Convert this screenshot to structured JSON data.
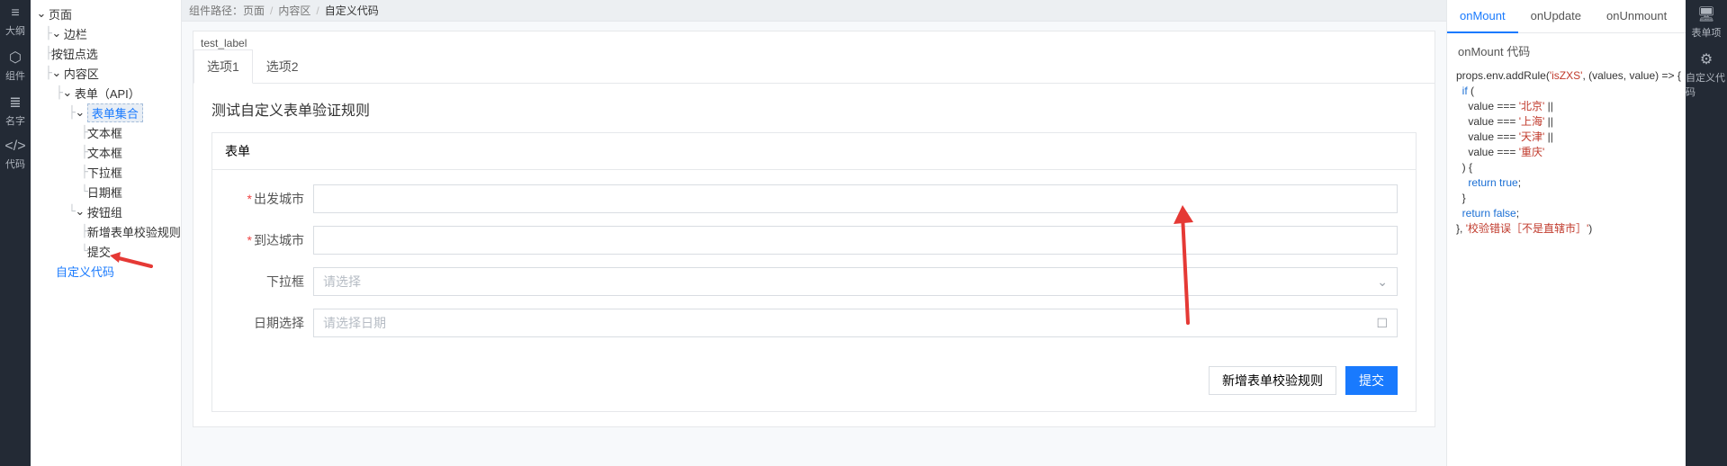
{
  "left_rail": [
    {
      "icon": "≡",
      "label": "大纲"
    },
    {
      "icon": "⬡",
      "label": "组件"
    },
    {
      "icon": "≣",
      "label": "名字"
    },
    {
      "icon": "</>",
      "label": "代码"
    }
  ],
  "tree": {
    "root_label": "页面",
    "items": [
      {
        "label": "边栏",
        "indent": 1
      },
      {
        "label": "按钮点选",
        "indent": 1
      },
      {
        "label": "内容区",
        "indent": 0,
        "collapsible": true
      },
      {
        "label": "表单（API）",
        "indent": 1,
        "collapsible": true
      },
      {
        "label": "表单集合",
        "indent": 2,
        "collapsible": true,
        "highlight": true
      },
      {
        "label": "文本框",
        "indent": 3
      },
      {
        "label": "文本框",
        "indent": 3
      },
      {
        "label": "下拉框",
        "indent": 3
      },
      {
        "label": "日期框",
        "indent": 3
      },
      {
        "label": "按钮组",
        "indent": 2,
        "collapsible": true
      },
      {
        "label": "新增表单校验规则",
        "indent": 3
      },
      {
        "label": "提交",
        "indent": 3
      },
      {
        "label": "自定义代码",
        "indent": -1,
        "link": true
      }
    ]
  },
  "breadcrumb": {
    "label_prefix": "组件路径：",
    "parts": [
      "页面",
      "内容区",
      "自定义代码"
    ]
  },
  "card": {
    "label": "test_label",
    "tabs": [
      "选项1",
      "选项2"
    ],
    "title": "测试自定义表单验证规则",
    "form_title": "表单",
    "fields": [
      {
        "label": "出发城市",
        "required": true,
        "type": "text"
      },
      {
        "label": "到达城市",
        "required": true,
        "type": "text"
      },
      {
        "label": "下拉框",
        "required": false,
        "type": "select",
        "placeholder": "请选择"
      },
      {
        "label": "日期选择",
        "required": false,
        "type": "date",
        "placeholder": "请选择日期"
      }
    ],
    "buttons": {
      "add_rule": "新增表单校验规则",
      "submit": "提交"
    }
  },
  "code_panel": {
    "tabs": [
      "onMount",
      "onUpdate",
      "onUnmount"
    ],
    "active_tab": 0,
    "title": "onMount 代码",
    "code_tokens": [
      {
        "t": "props.env.addRule(",
        "c": "pl"
      },
      {
        "t": "'isZXS'",
        "c": "str"
      },
      {
        "t": ", (values, value) => {\n  ",
        "c": "pl"
      },
      {
        "t": "if",
        "c": "kw"
      },
      {
        "t": " (\n    value === ",
        "c": "pl"
      },
      {
        "t": "'北京'",
        "c": "str"
      },
      {
        "t": " ||\n    value === ",
        "c": "pl"
      },
      {
        "t": "'上海'",
        "c": "str"
      },
      {
        "t": " ||\n    value === ",
        "c": "pl"
      },
      {
        "t": "'天津'",
        "c": "str"
      },
      {
        "t": " ||\n    value === ",
        "c": "pl"
      },
      {
        "t": "'重庆'",
        "c": "str"
      },
      {
        "t": "\n  ) {\n    ",
        "c": "pl"
      },
      {
        "t": "return true",
        "c": "kw"
      },
      {
        "t": ";\n  }\n  ",
        "c": "pl"
      },
      {
        "t": "return false",
        "c": "kw"
      },
      {
        "t": ";\n}, ",
        "c": "pl"
      },
      {
        "t": "'校验错误［不是直辖市］'",
        "c": "str"
      },
      {
        "t": ")",
        "c": "pl"
      }
    ]
  },
  "right_rail": [
    {
      "icon": "🖥",
      "label": "表单项"
    },
    {
      "icon": "⚙",
      "label": "自定义代码"
    }
  ]
}
